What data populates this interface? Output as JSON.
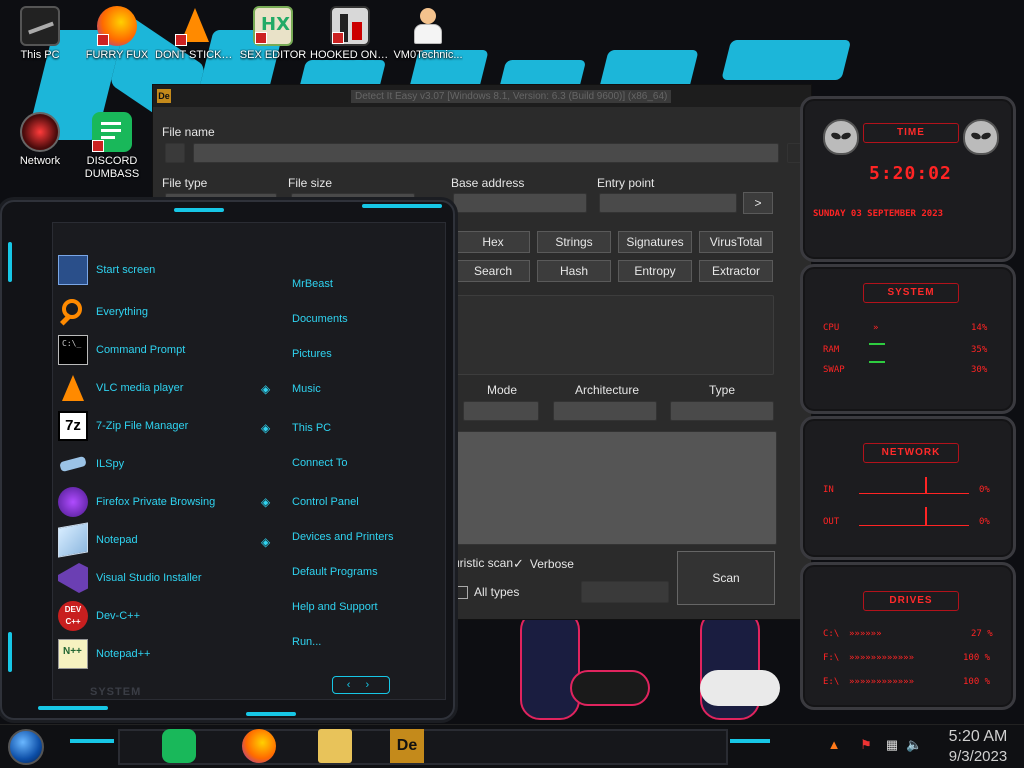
{
  "desktop": {
    "icons": [
      {
        "label": "This PC"
      },
      {
        "label": "FURRY FUX"
      },
      {
        "label": "DONT STICK THIS IN YO..."
      },
      {
        "label": "SEX EDITOR"
      },
      {
        "label": "HOOKED ON XONIX"
      },
      {
        "label": "VM0Technic..."
      },
      {
        "label": "Network"
      },
      {
        "label": "DISCORD DUMBASS"
      }
    ]
  },
  "die": {
    "title": "Detect It Easy v3.07 [Windows 8.1, Version: 6.3 (Build 9600)] (x86_64)",
    "file_name_label": "File name",
    "file_type_label": "File type",
    "file_size_label": "File size",
    "base_address_label": "Base address",
    "entry_point_label": "Entry point",
    "entry_go": ">",
    "buttons_row1": [
      "Hex",
      "Strings",
      "Signatures",
      "VirusTotal"
    ],
    "buttons_row2": [
      "Search",
      "Hash",
      "Entropy",
      "Extractor"
    ],
    "mode_label": "Mode",
    "architecture_label": "Architecture",
    "type_label": "Type",
    "heuristic_label": "uristic scan",
    "verbose_label": "Verbose",
    "all_types_label": "All types",
    "scan_label": "Scan"
  },
  "startmenu": {
    "left_items": [
      {
        "label": "Start screen",
        "icon": "start-screen-icon"
      },
      {
        "label": "Everything",
        "icon": "magnifier-icon"
      },
      {
        "label": "Command Prompt",
        "icon": "cmd-icon"
      },
      {
        "label": "VLC media player",
        "icon": "vlc-icon"
      },
      {
        "label": "7-Zip File Manager",
        "icon": "7zip-icon"
      },
      {
        "label": "ILSpy",
        "icon": "ilspy-icon"
      },
      {
        "label": "Firefox Private Browsing",
        "icon": "firefox-private-icon"
      },
      {
        "label": "Notepad",
        "icon": "notepad-icon"
      },
      {
        "label": "Visual Studio Installer",
        "icon": "visual-studio-icon"
      },
      {
        "label": "Dev-C++",
        "icon": "devcpp-icon"
      },
      {
        "label": "Notepad++",
        "icon": "notepadpp-icon"
      }
    ],
    "right_items": [
      {
        "label": "MrBeast"
      },
      {
        "label": "Documents"
      },
      {
        "label": "Pictures"
      },
      {
        "label": "Music"
      },
      {
        "label": "This PC"
      },
      {
        "label": "Connect To"
      },
      {
        "label": "Control Panel"
      },
      {
        "label": "Devices and Printers"
      },
      {
        "label": "Default Programs"
      },
      {
        "label": "Help and Support"
      },
      {
        "label": "Run..."
      }
    ],
    "footer_label": "SYSTEM",
    "arrows": "‹ ›"
  },
  "gadgets": {
    "time": {
      "title": "TIME",
      "clock": "5:20:02",
      "date": "SUNDAY 03 SEPTEMBER 2023"
    },
    "system": {
      "title": "SYSTEM",
      "rows": [
        {
          "label": "CPU",
          "value": "14%"
        },
        {
          "label": "RAM",
          "value": "35%"
        },
        {
          "label": "SWAP",
          "value": "30%"
        }
      ]
    },
    "network": {
      "title": "NETWORK",
      "rows": [
        {
          "label": "IN",
          "value": "0%"
        },
        {
          "label": "OUT",
          "value": "0%"
        }
      ]
    },
    "drives": {
      "title": "DRIVES",
      "rows": [
        {
          "label": "C:\\",
          "value": "27 %"
        },
        {
          "label": "F:\\",
          "value": "100 %"
        },
        {
          "label": "E:\\",
          "value": "100 %"
        }
      ]
    }
  },
  "taskbar": {
    "time": "5:20 AM",
    "date": "9/3/2023"
  },
  "colors": {
    "accent_cyan": "#17c7e6",
    "gadget_red": "#ff2424"
  }
}
